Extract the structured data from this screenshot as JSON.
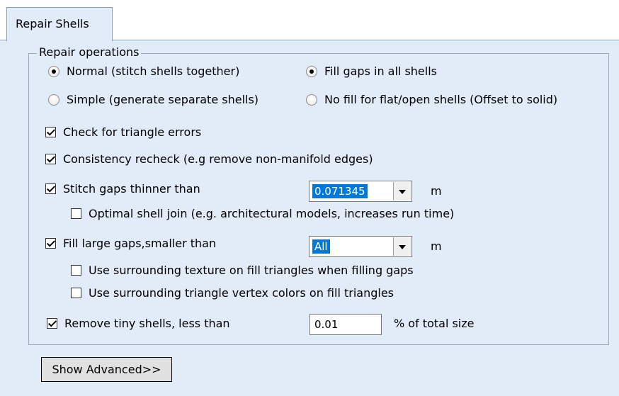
{
  "tab": {
    "label": "Repair Shells"
  },
  "group": {
    "title": "Repair operations"
  },
  "radios": {
    "normal": {
      "label": "Normal (stitch shells together)",
      "checked": true
    },
    "simple": {
      "label": "Simple (generate separate shells)",
      "checked": false
    },
    "fill_all": {
      "label": "Fill gaps in all shells",
      "checked": true
    },
    "no_fill": {
      "label": "No fill for flat/open shells (Offset to solid)",
      "checked": false
    }
  },
  "checks": {
    "triangle_errors": {
      "label": "Check for triangle errors",
      "checked": true
    },
    "consistency": {
      "label": "Consistency recheck (e.g remove non-manifold edges)",
      "checked": true
    },
    "stitch_gaps": {
      "label": "Stitch gaps thinner than",
      "checked": true
    },
    "optimal_join": {
      "label": "Optimal shell join (e.g. architectural models, increases run time)",
      "checked": false
    },
    "fill_large": {
      "label": "Fill large gaps,smaller than",
      "checked": true
    },
    "surround_texture": {
      "label": "Use surrounding texture on fill triangles when filling gaps",
      "checked": false
    },
    "surround_colors": {
      "label": "Use surrounding triangle vertex colors on fill triangles",
      "checked": false
    },
    "remove_tiny": {
      "label": "Remove tiny shells, less than",
      "checked": true
    }
  },
  "fields": {
    "stitch_value": "0.071345",
    "stitch_unit": "m",
    "fill_value": "All",
    "fill_unit": "m",
    "tiny_value": "0.01",
    "tiny_unit": "% of total size"
  },
  "buttons": {
    "show_advanced": "Show Advanced>>"
  }
}
